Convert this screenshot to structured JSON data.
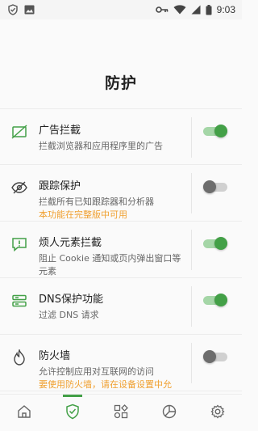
{
  "status_bar": {
    "time": "9:03"
  },
  "page": {
    "title": "防护"
  },
  "features": [
    {
      "title": "广告拦截",
      "desc": "拦截浏览器和应用程序里的广告",
      "warn": "",
      "enabled": true,
      "icon": "ad-block-icon"
    },
    {
      "title": "跟踪保护",
      "desc": "拦截所有已知跟踪器和分析器",
      "warn": "本功能在完整版中可用",
      "enabled": false,
      "icon": "eye-slash-icon"
    },
    {
      "title": "烦人元素拦截",
      "desc": "阻止 Cookie 通知或页内弹出窗口等元素",
      "warn": "",
      "enabled": true,
      "icon": "chat-alert-icon"
    },
    {
      "title": "DNS保护功能",
      "desc": "过滤 DNS 请求",
      "warn": "",
      "enabled": true,
      "icon": "server-icon"
    },
    {
      "title": "防火墙",
      "desc": "允许控制应用对互联网的访问",
      "warn": "要使用防火墙，请在设备设置中允",
      "enabled": false,
      "icon": "flame-icon"
    }
  ],
  "bottom_nav": [
    {
      "name": "home",
      "icon": "home-icon",
      "active": false
    },
    {
      "name": "protection",
      "icon": "shield-check-icon",
      "active": true
    },
    {
      "name": "apps",
      "icon": "apps-grid-icon",
      "active": false
    },
    {
      "name": "statistics",
      "icon": "pie-chart-icon",
      "active": false
    },
    {
      "name": "settings",
      "icon": "gear-icon",
      "active": false
    }
  ],
  "colors": {
    "accent": "#43a047",
    "warning": "#f0a030",
    "toggle_off": "#6d6d6d"
  }
}
